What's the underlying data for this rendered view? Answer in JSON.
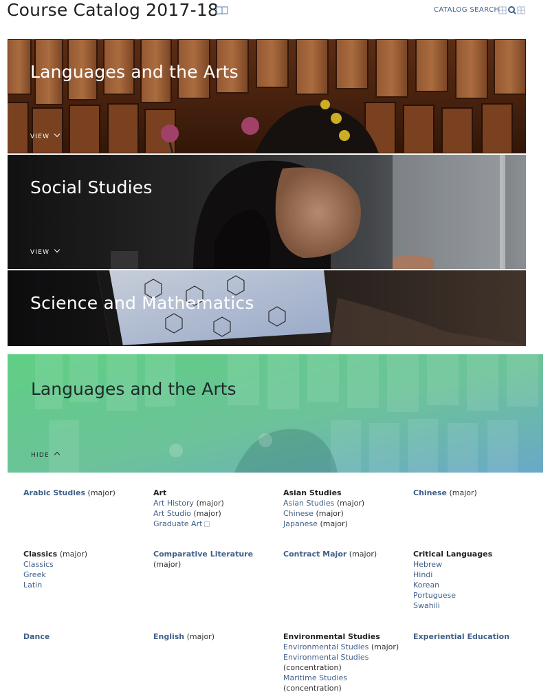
{
  "header": {
    "title": "Course Catalog 2017-18",
    "search_label": "CATALOG SEARCH"
  },
  "banners": [
    {
      "title": "Languages and the Arts",
      "toggle": "VIEW"
    },
    {
      "title": "Social Studies",
      "toggle": "VIEW"
    },
    {
      "title": "Science and Mathematics"
    }
  ],
  "expanded": {
    "title": "Languages and the Arts",
    "toggle": "HIDE"
  },
  "programs": [
    {
      "head": "Arabic Studies",
      "head_is_link": true,
      "note": "(major)",
      "items": []
    },
    {
      "head": "Art",
      "head_is_link": false,
      "note": "",
      "items": [
        {
          "label": "Art History",
          "note": "(major)"
        },
        {
          "label": "Art Studio",
          "note": "(major)"
        },
        {
          "label": "Graduate Art",
          "note": "",
          "external": true
        }
      ]
    },
    {
      "head": "Asian Studies",
      "head_is_link": false,
      "note": "",
      "items": [
        {
          "label": "Asian Studies",
          "note": "(major)"
        },
        {
          "label": "Chinese",
          "note": "(major)"
        },
        {
          "label": "Japanese",
          "note": "(major)"
        }
      ]
    },
    {
      "head": "Chinese",
      "head_is_link": true,
      "note": "(major)",
      "items": []
    },
    {
      "head": "Classics",
      "head_is_link": false,
      "note": "(major)",
      "items": [
        {
          "label": "Classics",
          "note": ""
        },
        {
          "label": "Greek",
          "note": ""
        },
        {
          "label": "Latin",
          "note": ""
        }
      ]
    },
    {
      "head": "Comparative Literature",
      "head_is_link": true,
      "note": "(major)",
      "note_on_new_line": true,
      "items": []
    },
    {
      "head": "Contract Major",
      "head_is_link": true,
      "note": "(major)",
      "items": []
    },
    {
      "head": "Critical Languages",
      "head_is_link": false,
      "note": "",
      "items": [
        {
          "label": "Hebrew",
          "note": ""
        },
        {
          "label": "Hindi",
          "note": ""
        },
        {
          "label": "Korean",
          "note": ""
        },
        {
          "label": "Portuguese",
          "note": ""
        },
        {
          "label": "Swahili",
          "note": ""
        }
      ]
    },
    {
      "head": "Dance",
      "head_is_link": true,
      "note": "",
      "items": []
    },
    {
      "head": "English",
      "head_is_link": true,
      "note": "(major)",
      "items": []
    },
    {
      "head": "Environmental Studies",
      "head_is_link": false,
      "note": "",
      "items": [
        {
          "label": "Environmental Studies",
          "note": "(major)"
        },
        {
          "label": "Environmental Studies",
          "note": "(concentration)",
          "note_on_new_line": true
        },
        {
          "label": "Maritime Studies",
          "note": "(concentration)"
        }
      ]
    },
    {
      "head": "Experiential Education",
      "head_is_link": true,
      "note": "",
      "items": []
    }
  ],
  "colors": {
    "link": "#3f5f8a",
    "expanded_gradient_start": "#5fcf83",
    "expanded_gradient_end": "#6aa8c8"
  },
  "icons": {
    "title_icon": "book-icon",
    "search_icon": "search-icon"
  }
}
